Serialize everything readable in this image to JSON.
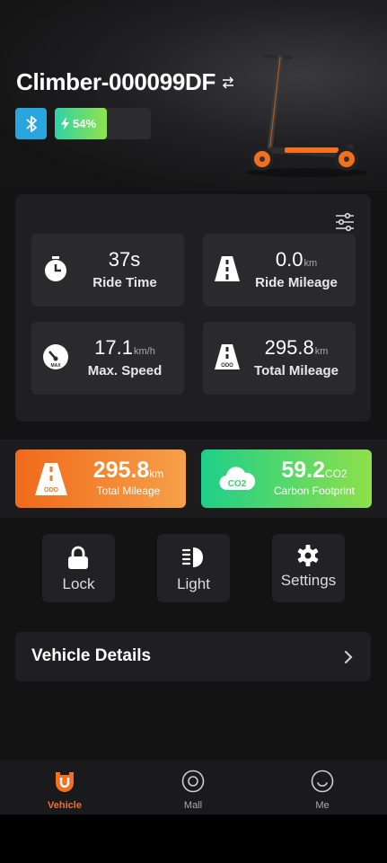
{
  "vehicle": {
    "name": "Climber-000099DF",
    "battery_percent": 54,
    "battery_label": "54%"
  },
  "stats": [
    {
      "value": "37s",
      "unit": "",
      "label": "Ride Time",
      "icon": "stopwatch-icon"
    },
    {
      "value": "0.0",
      "unit": "km",
      "label": "Ride Mileage",
      "icon": "road-icon"
    },
    {
      "value": "17.1",
      "unit": "km/h",
      "label": "Max. Speed",
      "icon": "speedometer-icon"
    },
    {
      "value": "295.8",
      "unit": "km",
      "label": "Total Mileage",
      "icon": "odometer-road-icon"
    }
  ],
  "summary": {
    "mileage": {
      "value": "295.8",
      "unit": "km",
      "label": "Total Mileage",
      "icon_text": "ODO"
    },
    "carbon": {
      "value": "59.2",
      "unit": "CO2",
      "label": "Carbon Footprint",
      "icon_text": "CO2"
    }
  },
  "controls": [
    {
      "label": "Lock",
      "icon": "lock-icon"
    },
    {
      "label": "Light",
      "icon": "headlight-icon"
    },
    {
      "label": "Settings",
      "icon": "gear-icon"
    }
  ],
  "details": {
    "label": "Vehicle Details"
  },
  "nav": [
    {
      "label": "Vehicle",
      "icon": "vehicle-icon",
      "active": true
    },
    {
      "label": "Mall",
      "icon": "mall-icon",
      "active": false
    },
    {
      "label": "Me",
      "icon": "smile-icon",
      "active": false
    }
  ],
  "colors": {
    "accent": "#f37021",
    "bluetooth": "#29a6df",
    "battery_start": "#2ed3a5",
    "battery_end": "#8fe34b",
    "background": "#131313",
    "card": "#1f1f21"
  }
}
